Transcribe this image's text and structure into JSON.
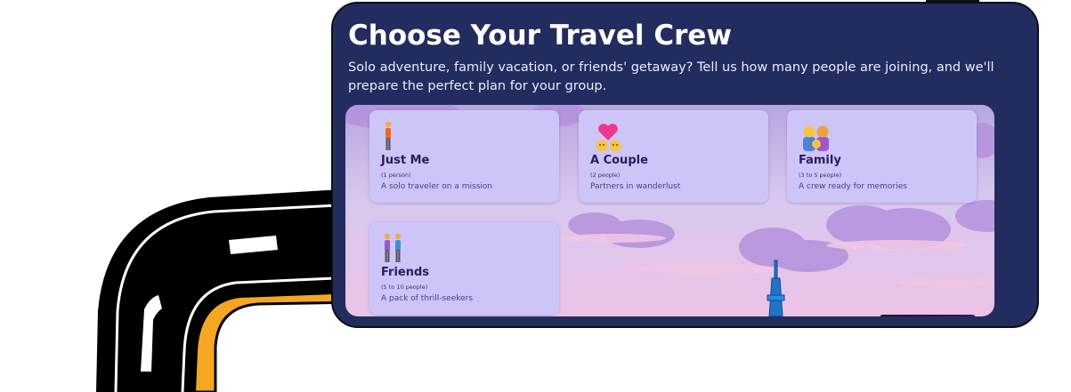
{
  "header": {
    "title": "Choose Your Travel Crew",
    "subtitle": "Solo adventure, family vacation, or friends' getaway? Tell us how many people are joining, and we'll prepare the perfect plan for your group."
  },
  "options": [
    {
      "name": "Just Me",
      "count": "(1 person)",
      "description": "A solo traveler on a mission",
      "icon": "person-icon"
    },
    {
      "name": "A Couple",
      "count": "(2 people)",
      "description": "Partners in wanderlust",
      "icon": "couple-heart-icon"
    },
    {
      "name": "Family",
      "count": "(3 to 5 people)",
      "description": "A crew ready for memories",
      "icon": "family-icon"
    },
    {
      "name": "Friends",
      "count": "(5 to 10 people)",
      "description": "A pack of thrill-seekers",
      "icon": "friends-icon"
    }
  ],
  "colors": {
    "panel": "#232c5e",
    "card": "#cdc5f8",
    "road": "#000000",
    "road_edge": "#f5a623"
  }
}
